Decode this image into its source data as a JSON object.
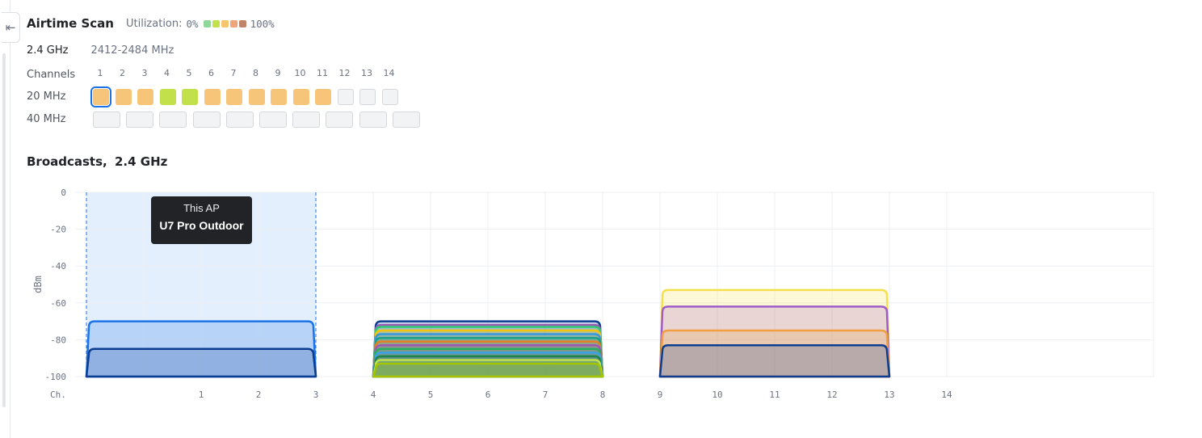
{
  "header": {
    "title": "Airtime Scan",
    "utilization_label": "Utilization:",
    "util_min": "0%",
    "util_max": "100%",
    "legend_colors": [
      "#8fd89a",
      "#c2e04a",
      "#f6c56e",
      "#f0a47a",
      "#c1846a"
    ]
  },
  "band": {
    "name": "2.4 GHz",
    "range": "2412-2484 MHz"
  },
  "channels": {
    "label": "Channels",
    "numbers": [
      "1",
      "2",
      "3",
      "4",
      "5",
      "6",
      "7",
      "8",
      "9",
      "10",
      "11",
      "12",
      "13",
      "14"
    ],
    "row20_label": "20 MHz",
    "row40_label": "40 MHz",
    "row20_colors": [
      "#f7c57a",
      "#f7c57a",
      "#f7c57a",
      "#c2e04a",
      "#c2e04a",
      "#f7c57a",
      "#f7c57a",
      "#f7c57a",
      "#f7c57a",
      "#f7c57a",
      "#f7c57a",
      null,
      null,
      null
    ],
    "selected_channel": "1",
    "row40_count": 10
  },
  "broadcasts": {
    "title": "Broadcasts,",
    "band": "2.4 GHz"
  },
  "tooltip": {
    "line1": "This AP",
    "line2": "U7 Pro Outdoor"
  },
  "chart_data": {
    "type": "area",
    "ylabel": "dBm",
    "x_axis_label": "Ch.",
    "ylim": [
      -100,
      0
    ],
    "yticks": [
      "0",
      "-20",
      "-40",
      "-60",
      "-80",
      "-100"
    ],
    "xticks": [
      "1",
      "2",
      "3",
      "4",
      "5",
      "6",
      "7",
      "8",
      "9",
      "10",
      "11",
      "12",
      "13",
      "14"
    ],
    "grid": true,
    "highlight_range": [
      -1,
      3
    ],
    "series": [
      {
        "channel_from": -1,
        "channel_to": 3,
        "dbm": -70,
        "color": "#1a73e8"
      },
      {
        "channel_from": -1,
        "channel_to": 3,
        "dbm": -85,
        "color": "#0b3d91"
      },
      {
        "channel_from": 4,
        "channel_to": 8,
        "dbm": -70,
        "color": "#0b3d91"
      },
      {
        "channel_from": 4,
        "channel_to": 8,
        "dbm": -72,
        "color": "#9b59b6"
      },
      {
        "channel_from": 4,
        "channel_to": 8,
        "dbm": -73,
        "color": "#2ecc71"
      },
      {
        "channel_from": 4,
        "channel_to": 8,
        "dbm": -75,
        "color": "#f1c40f"
      },
      {
        "channel_from": 4,
        "channel_to": 8,
        "dbm": -77,
        "color": "#3498db"
      },
      {
        "channel_from": 4,
        "channel_to": 8,
        "dbm": -79,
        "color": "#16a085"
      },
      {
        "channel_from": 4,
        "channel_to": 8,
        "dbm": -81,
        "color": "#e67e22"
      },
      {
        "channel_from": 4,
        "channel_to": 8,
        "dbm": -83,
        "color": "#9b59b6"
      },
      {
        "channel_from": 4,
        "channel_to": 8,
        "dbm": -85,
        "color": "#27ae60"
      },
      {
        "channel_from": 4,
        "channel_to": 8,
        "dbm": -87,
        "color": "#3aa0e8"
      },
      {
        "channel_from": 4,
        "channel_to": 8,
        "dbm": -89,
        "color": "#1e8449"
      },
      {
        "channel_from": 4,
        "channel_to": 8,
        "dbm": -91,
        "color": "#c2e04a"
      },
      {
        "channel_from": 4,
        "channel_to": 8,
        "dbm": -93,
        "color": "#a3c400"
      },
      {
        "channel_from": 9,
        "channel_to": 13,
        "dbm": -53,
        "color": "#f4e04d"
      },
      {
        "channel_from": 9,
        "channel_to": 13,
        "dbm": -62,
        "color": "#a05cc8"
      },
      {
        "channel_from": 9,
        "channel_to": 13,
        "dbm": -75,
        "color": "#f0a040"
      },
      {
        "channel_from": 9,
        "channel_to": 13,
        "dbm": -83,
        "color": "#0b3d91"
      }
    ]
  }
}
